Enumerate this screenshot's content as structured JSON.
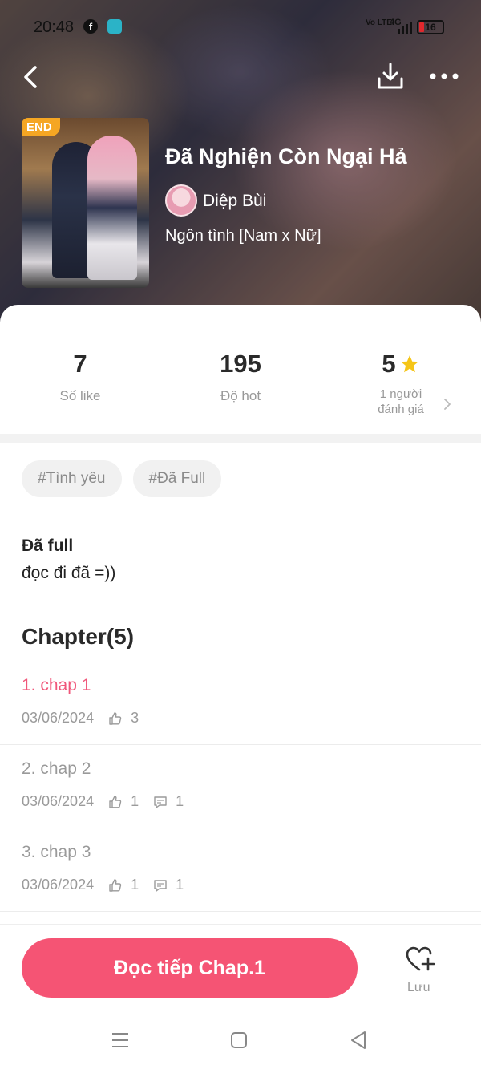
{
  "status_bar": {
    "time": "20:48",
    "network_label": "Vo LTE",
    "signal_label": "4G",
    "battery_level": "16"
  },
  "header": {
    "end_badge": "END",
    "title": "Đã Nghiện Còn Ngại Hả",
    "author": "Diệp Bùi",
    "genre": "Ngôn tình [Nam x Nữ]"
  },
  "stats": {
    "likes": {
      "value": "7",
      "label": "Số like"
    },
    "hot": {
      "value": "195",
      "label": "Độ hot"
    },
    "rating": {
      "value": "5",
      "line1": "1 người",
      "line2": "đánh giá"
    }
  },
  "tags": [
    "#Tình yêu",
    "#Đã Full"
  ],
  "description": {
    "line1": "Đã full",
    "line2": "đọc đi đã =))"
  },
  "chapters_heading": "Chapter(5)",
  "chapters": [
    {
      "title": "1. chap 1",
      "date": "03/06/2024",
      "likes": "3",
      "comments": null,
      "active": true
    },
    {
      "title": "2. chap 2",
      "date": "03/06/2024",
      "likes": "1",
      "comments": "1",
      "active": false
    },
    {
      "title": "3. chap 3",
      "date": "03/06/2024",
      "likes": "1",
      "comments": "1",
      "active": false
    }
  ],
  "bottom_bar": {
    "read_button": "Đọc tiếp Chap.1",
    "save_label": "Lưu"
  },
  "colors": {
    "accent": "#f55474",
    "active_chapter": "#f0577a",
    "star": "#f5c518"
  },
  "icons": [
    "back-icon",
    "download-icon",
    "more-icon",
    "star-icon",
    "chevron-right-icon",
    "like-icon",
    "comment-icon",
    "heart-add-icon",
    "menu-icon",
    "home-icon",
    "back-triangle-icon"
  ]
}
